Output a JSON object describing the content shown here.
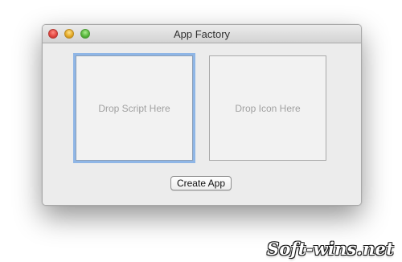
{
  "window": {
    "title": "App Factory"
  },
  "drop_zones": {
    "script_label": "Drop Script Here",
    "icon_label": "Drop Icon Here"
  },
  "actions": {
    "create_label": "Create App"
  },
  "watermark": {
    "text": "Soft-wins.net"
  },
  "theme": {
    "focus_ring_color": "#8fb6e6",
    "close_color": "#e0443e",
    "minimize_color": "#e2a622",
    "zoom_color": "#54b43a"
  }
}
